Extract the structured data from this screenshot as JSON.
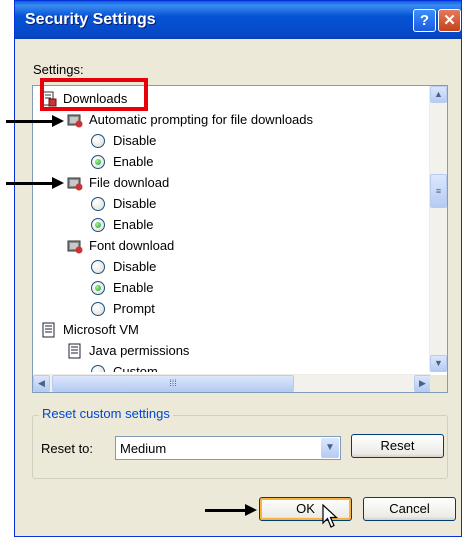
{
  "window": {
    "title": "Security Settings",
    "help_button": "?",
    "close_button": "✕"
  },
  "settings_label": "Settings:",
  "tree": {
    "downloads": "Downloads",
    "auto_prompt": "Automatic prompting for file downloads",
    "file_download": "File download",
    "font_download": "Font download",
    "microsoft_vm": "Microsoft VM",
    "java_permissions": "Java permissions",
    "custom": "Custom",
    "disable": "Disable",
    "enable": "Enable",
    "prompt": "Prompt"
  },
  "scroll": {
    "up": "▲",
    "down": "▼",
    "left": "◀",
    "right": "▶"
  },
  "reset_group": {
    "legend": "Reset custom settings",
    "reset_to_label": "Reset to:",
    "selected": "Medium",
    "reset_button": "Reset"
  },
  "buttons": {
    "ok": "OK",
    "cancel": "Cancel"
  },
  "colors": {
    "highlight_box": "#E8000B",
    "title_bar": "#0653D6"
  }
}
